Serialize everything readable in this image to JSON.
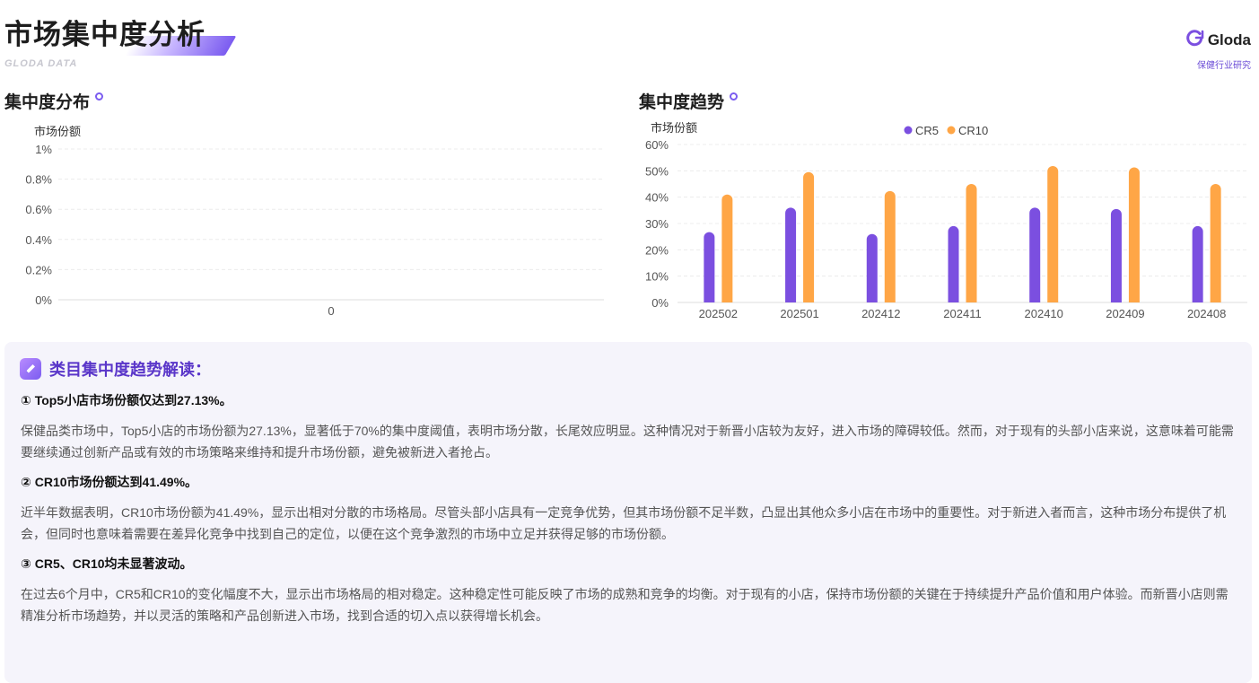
{
  "header": {
    "title": "市场集中度分析",
    "subtitle": "GLODA DATA",
    "brand_name": "Gloda",
    "brand_sub": "保健行业研究"
  },
  "sections": {
    "distribution_title": "集中度分布",
    "trend_title": "集中度趋势"
  },
  "chart_data": [
    {
      "type": "bar",
      "ylabel": "市场份额",
      "categories": [
        "0"
      ],
      "series": [],
      "ylim": [
        0,
        1
      ],
      "yticks": [
        "0%",
        "0.2%",
        "0.4%",
        "0.6%",
        "0.8%",
        "1%"
      ],
      "grid": true
    },
    {
      "type": "bar",
      "ylabel": "市场份额",
      "categories": [
        "202502",
        "202501",
        "202412",
        "202411",
        "202410",
        "202409",
        "202408"
      ],
      "series": [
        {
          "name": "CR5",
          "values": [
            26.7,
            36.0,
            26.0,
            29.0,
            36.0,
            35.5,
            29.0
          ],
          "color": "#7b4fe0"
        },
        {
          "name": "CR10",
          "values": [
            41.0,
            49.5,
            42.3,
            45.0,
            51.8,
            51.3,
            45.0
          ],
          "color": "#ffa646"
        }
      ],
      "ylim": [
        0,
        60
      ],
      "yticks": [
        "0%",
        "10%",
        "20%",
        "30%",
        "40%",
        "50%",
        "60%"
      ],
      "legend": "top-center",
      "grid": true
    }
  ],
  "analysis": {
    "title": "类目集中度趋势解读：",
    "icon": "pen-icon",
    "items": [
      {
        "title": "① Top5小店市场份额仅达到27.13%。",
        "body": "保健品类市场中，Top5小店的市场份额为27.13%，显著低于70%的集中度阈值，表明市场分散，长尾效应明显。这种情况对于新晋小店较为友好，进入市场的障碍较低。然而，对于现有的头部小店来说，这意味着可能需要继续通过创新产品或有效的市场策略来维持和提升市场份额，避免被新进入者抢占。"
      },
      {
        "title": "② CR10市场份额达到41.49%。",
        "body": "近半年数据表明，CR10市场份额为41.49%，显示出相对分散的市场格局。尽管头部小店具有一定竞争优势，但其市场份额不足半数，凸显出其他众多小店在市场中的重要性。对于新进入者而言，这种市场分布提供了机会，但同时也意味着需要在差异化竞争中找到自己的定位，以便在这个竞争激烈的市场中立足并获得足够的市场份额。"
      },
      {
        "title": "③ CR5、CR10均未显著波动。",
        "body": "在过去6个月中，CR5和CR10的变化幅度不大，显示出市场格局的相对稳定。这种稳定性可能反映了市场的成熟和竞争的均衡。对于现有的小店，保持市场份额的关键在于持续提升产品价值和用户体验。而新晋小店则需精准分析市场趋势，并以灵活的策略和产品创新进入市场，找到合适的切入点以获得增长机会。"
      }
    ]
  }
}
